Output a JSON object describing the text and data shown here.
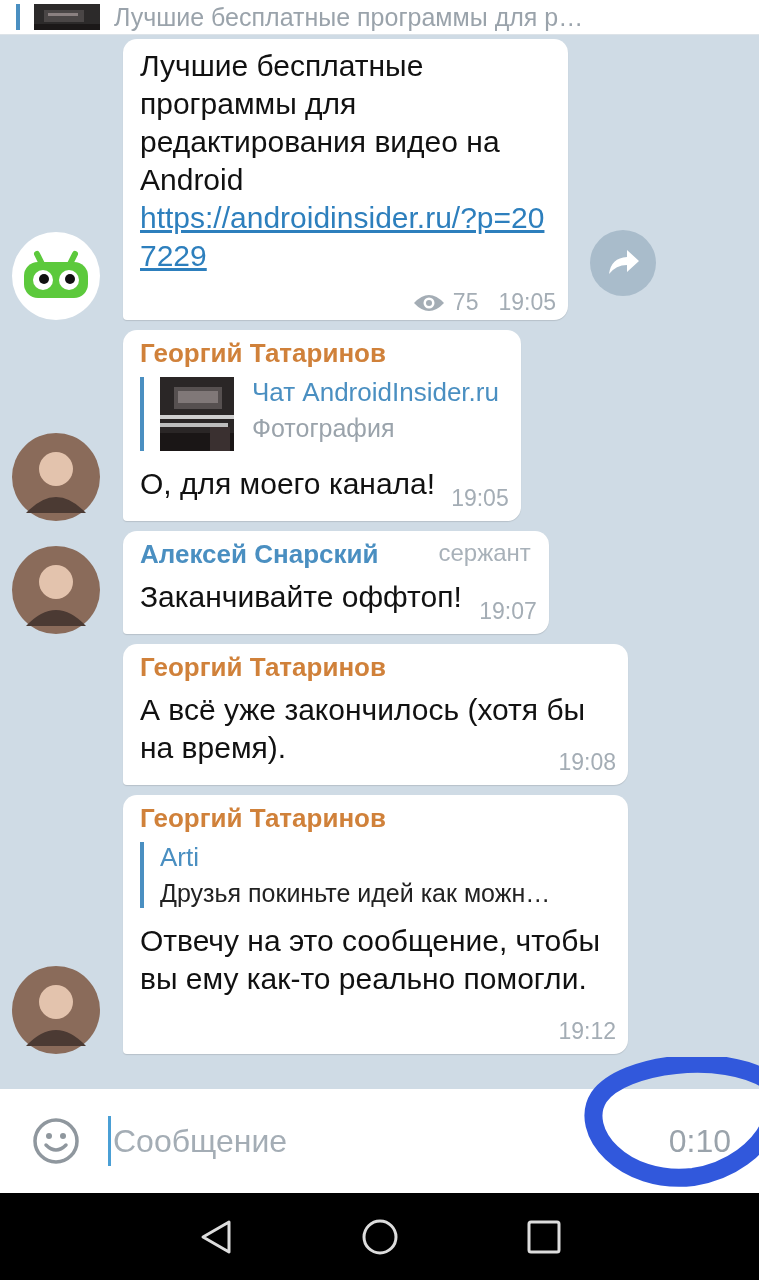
{
  "pinned": {
    "text": "Лучшие бесплатные программы для р…"
  },
  "messages": [
    {
      "kind": "channel_post",
      "avatar": {
        "kind": "logo"
      },
      "text": "Лучшие бесплатные программы для редактирования видео на Android",
      "link": "https://androidinsider.ru/?p=207229",
      "views": "75",
      "time": "19:05",
      "share": true
    },
    {
      "kind": "group",
      "avatar": {
        "kind": "person"
      },
      "author": "Георгий Татаринов",
      "color": "#d0813a",
      "reply": {
        "title": "Чат AndroidInsider.ru",
        "subtitle": "Фотография"
      },
      "text": "О, для моего канала!",
      "time": "19:05"
    },
    {
      "kind": "group",
      "avatar": {
        "kind": "person"
      },
      "author": "Алексей Снарский",
      "color": "#4a8fc1",
      "badge": "сержант",
      "text": "Заканчивайте оффтоп!",
      "time": "19:07"
    },
    {
      "kind": "group",
      "author": "Георгий Татаринов",
      "color": "#d0813a",
      "text": "А всё уже закончилось (хотя бы на время).",
      "time": "19:08"
    },
    {
      "kind": "group",
      "avatar": {
        "kind": "person"
      },
      "author": "Георгий Татаринов",
      "color": "#d0813a",
      "reply": {
        "title": "Arti",
        "subtitle": "Друзья покиньте идей как можн…"
      },
      "text": "Отвечу на это сообщение, чтобы вы ему как-то реально помогли.",
      "time": "19:12"
    }
  ],
  "composer": {
    "placeholder": "Сообщение",
    "timer": "0:10"
  }
}
